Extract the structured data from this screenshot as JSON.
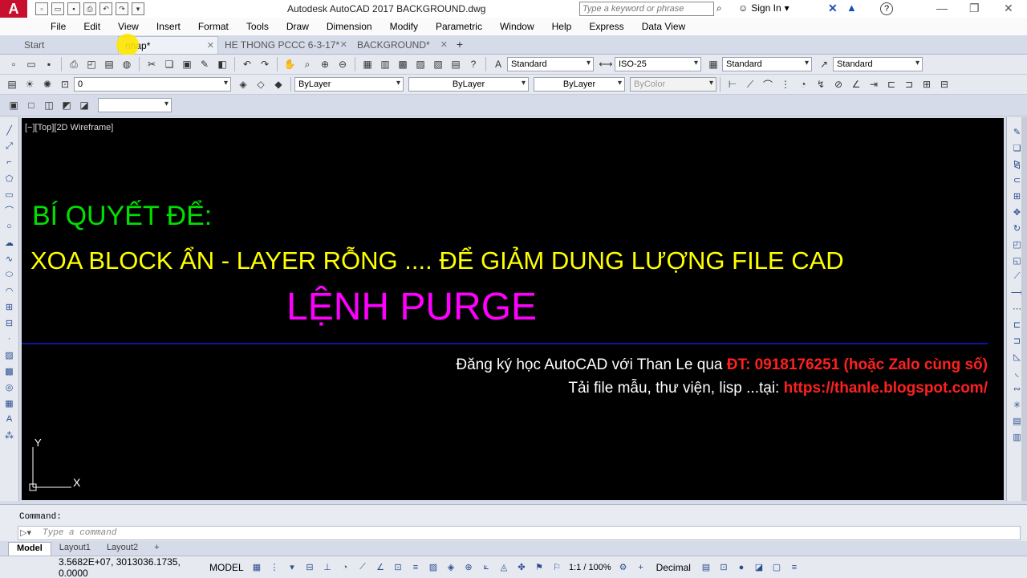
{
  "app": {
    "title": "Autodesk AutoCAD 2017    BACKGROUND.dwg",
    "logo": "A",
    "search_placeholder": "Type a keyword or phrase",
    "sign_in": "Sign In",
    "help": "?"
  },
  "menu": [
    "File",
    "Edit",
    "View",
    "Insert",
    "Format",
    "Tools",
    "Draw",
    "Dimension",
    "Modify",
    "Parametric",
    "Window",
    "Help",
    "Express",
    "Data View"
  ],
  "tabs": [
    {
      "label": "Start",
      "active": false,
      "closable": false
    },
    {
      "label": "nhap*",
      "active": true,
      "closable": true
    },
    {
      "label": "HE THONG PCCC 6-3-17*",
      "active": false,
      "closable": true
    },
    {
      "label": "BACKGROUND*",
      "active": false,
      "closable": true
    }
  ],
  "toolbar_styles": {
    "text_style": "Standard",
    "dim_style": "ISO-25",
    "table_style": "Standard",
    "mleader_style": "Standard"
  },
  "properties": {
    "layer": "0",
    "color": "ByLayer",
    "linetype": "ByLayer",
    "lineweight": "ByLayer",
    "plotstyle": "ByColor"
  },
  "canvas": {
    "viewport_label": "[−][Top][2D Wireframe]",
    "line1": "BÍ QUYẾT ĐỂ:",
    "line2": "XOA BLOCK ẨN - LAYER RỖNG .... ĐỂ GIẢM DUNG LƯỢNG FILE CAD",
    "line3": "LỆNH PURGE",
    "contact_prefix": "Đăng ký học AutoCAD  với Than Le qua ",
    "contact_phone": "ĐT: 0918176251 (hoặc Zalo cùng số)",
    "download_prefix": "Tải file mẫu, thư viện, lisp ...tại:  ",
    "download_url": "https://thanle.blogspot.com/",
    "ucs_y": "Y",
    "ucs_x": "X"
  },
  "command": {
    "history": "Command:",
    "placeholder": "Type a command"
  },
  "layouts": [
    "Model",
    "Layout1",
    "Layout2"
  ],
  "status": {
    "coords": "3.5682E+07, 3013036.1735, 0.0000",
    "space": "MODEL",
    "scale": "1:1 / 100%",
    "units": "Decimal"
  },
  "colors": {
    "canvas_bg": "#000000",
    "green": "#00e000",
    "yellow": "#ffff00",
    "magenta": "#ff00ff",
    "red": "#ff2020",
    "accent": "#c8102e"
  }
}
